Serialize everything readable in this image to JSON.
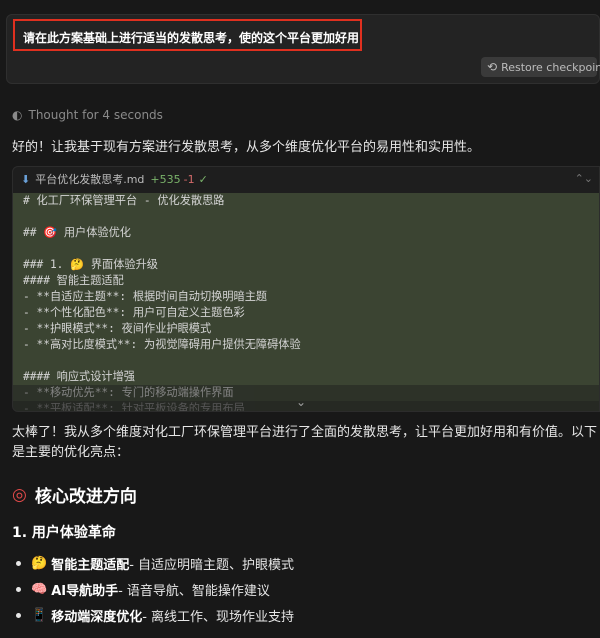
{
  "prompt": {
    "text": "请在此方案基础上进行适当的发散思考，使的这个平台更加好用",
    "restore_label": "Restore checkpoint"
  },
  "thought": {
    "label": "Thought for 4 seconds"
  },
  "intro": "好的！让我基于现有方案进行发散思考，从多个维度优化平台的易用性和实用性。",
  "file": {
    "name": "平台优化发散思考.md",
    "added": "+535",
    "removed": "-1",
    "check": "✓"
  },
  "code_lines": [
    "# 化工厂环保管理平台 - 优化发散思路",
    "",
    "## 🎯 用户体验优化",
    "",
    "### 1. 🤔 界面体验升级",
    "#### 智能主题适配",
    "- **自适应主题**: 根据时间自动切换明暗主题",
    "- **个性化配色**: 用户可自定义主题色彩",
    "- **护眼模式**: 夜间作业护眼模式",
    "- **高对比度模式**: 为视觉障碍用户提供无障碍体验",
    "",
    "#### 响应式设计增强",
    "- **移动优先**: 专门的移动端操作界面",
    "- **平板适配**: 针对平板设备的专用布局"
  ],
  "summary": "太棒了！我从多个维度对化工厂环保管理平台进行了全面的发散思考，让平台更加好用和有价值。以下是主要的优化亮点：",
  "heading_main": "核心改进方向",
  "heading_sub": "1. 用户体验革命",
  "bullets": [
    {
      "icon": "🤔",
      "bold": "智能主题适配",
      "rest": " - 自适应明暗主题、护眼模式"
    },
    {
      "icon": "🧠",
      "bold": "AI导航助手",
      "rest": " - 语音导航、智能操作建议"
    },
    {
      "icon": "📱",
      "bold": "移动端深度优化",
      "rest": " - 离线工作、现场作业支持"
    }
  ]
}
